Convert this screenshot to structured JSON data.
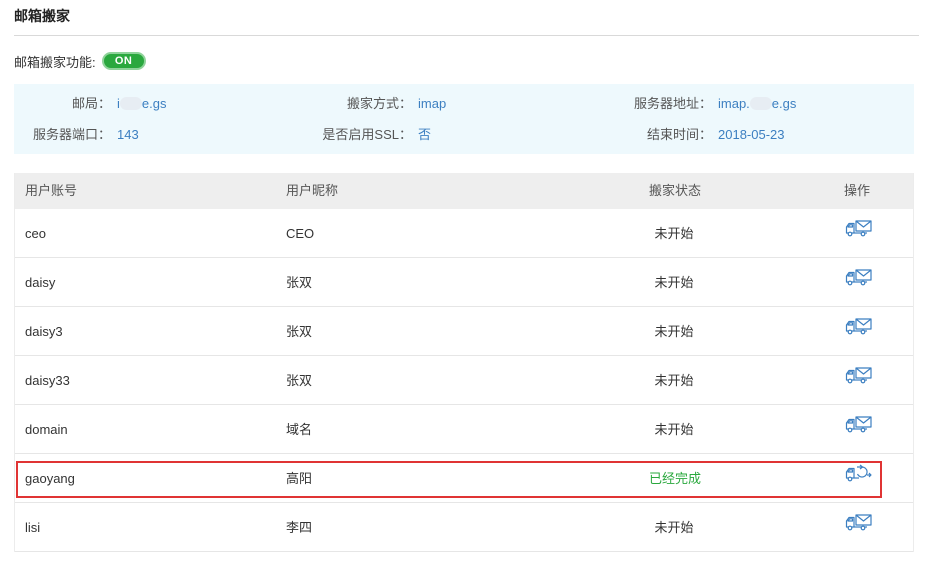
{
  "title": "邮箱搬家",
  "toggle": {
    "label": "邮箱搬家功能:",
    "state": "ON"
  },
  "info": {
    "mailbox_label": "邮局：",
    "mailbox_prefix": "i",
    "mailbox_suffix": "e.gs",
    "method_label": "搬家方式：",
    "method_value": "imap",
    "server_label": "服务器地址：",
    "server_prefix": "imap.",
    "server_suffix": "e.gs",
    "port_label": "服务器端口：",
    "port_value": "143",
    "ssl_label": "是否启用SSL：",
    "ssl_value": "否",
    "end_label": "结束时间：",
    "end_value": "2018-05-23"
  },
  "table": {
    "headers": [
      "用户账号",
      "用户昵称",
      "搬家状态",
      "操作"
    ],
    "rows": [
      {
        "account": "ceo",
        "nickname": "CEO",
        "status": "未开始",
        "done": false
      },
      {
        "account": "daisy",
        "nickname": "张双",
        "status": "未开始",
        "done": false
      },
      {
        "account": "daisy3",
        "nickname": "张双",
        "status": "未开始",
        "done": false
      },
      {
        "account": "daisy33",
        "nickname": "张双",
        "status": "未开始",
        "done": false
      },
      {
        "account": "domain",
        "nickname": "域名",
        "status": "未开始",
        "done": false
      },
      {
        "account": "gaoyang",
        "nickname": "高阳",
        "status": "已经完成",
        "done": true
      },
      {
        "account": "lisi",
        "nickname": "李四",
        "status": "未开始",
        "done": false
      }
    ]
  },
  "icons": {
    "move": "truck-mail-icon",
    "redo": "truck-refresh-icon"
  },
  "colors": {
    "accent": "#3c7fc1",
    "success": "#2aa83e",
    "highlight": "#e03434"
  }
}
